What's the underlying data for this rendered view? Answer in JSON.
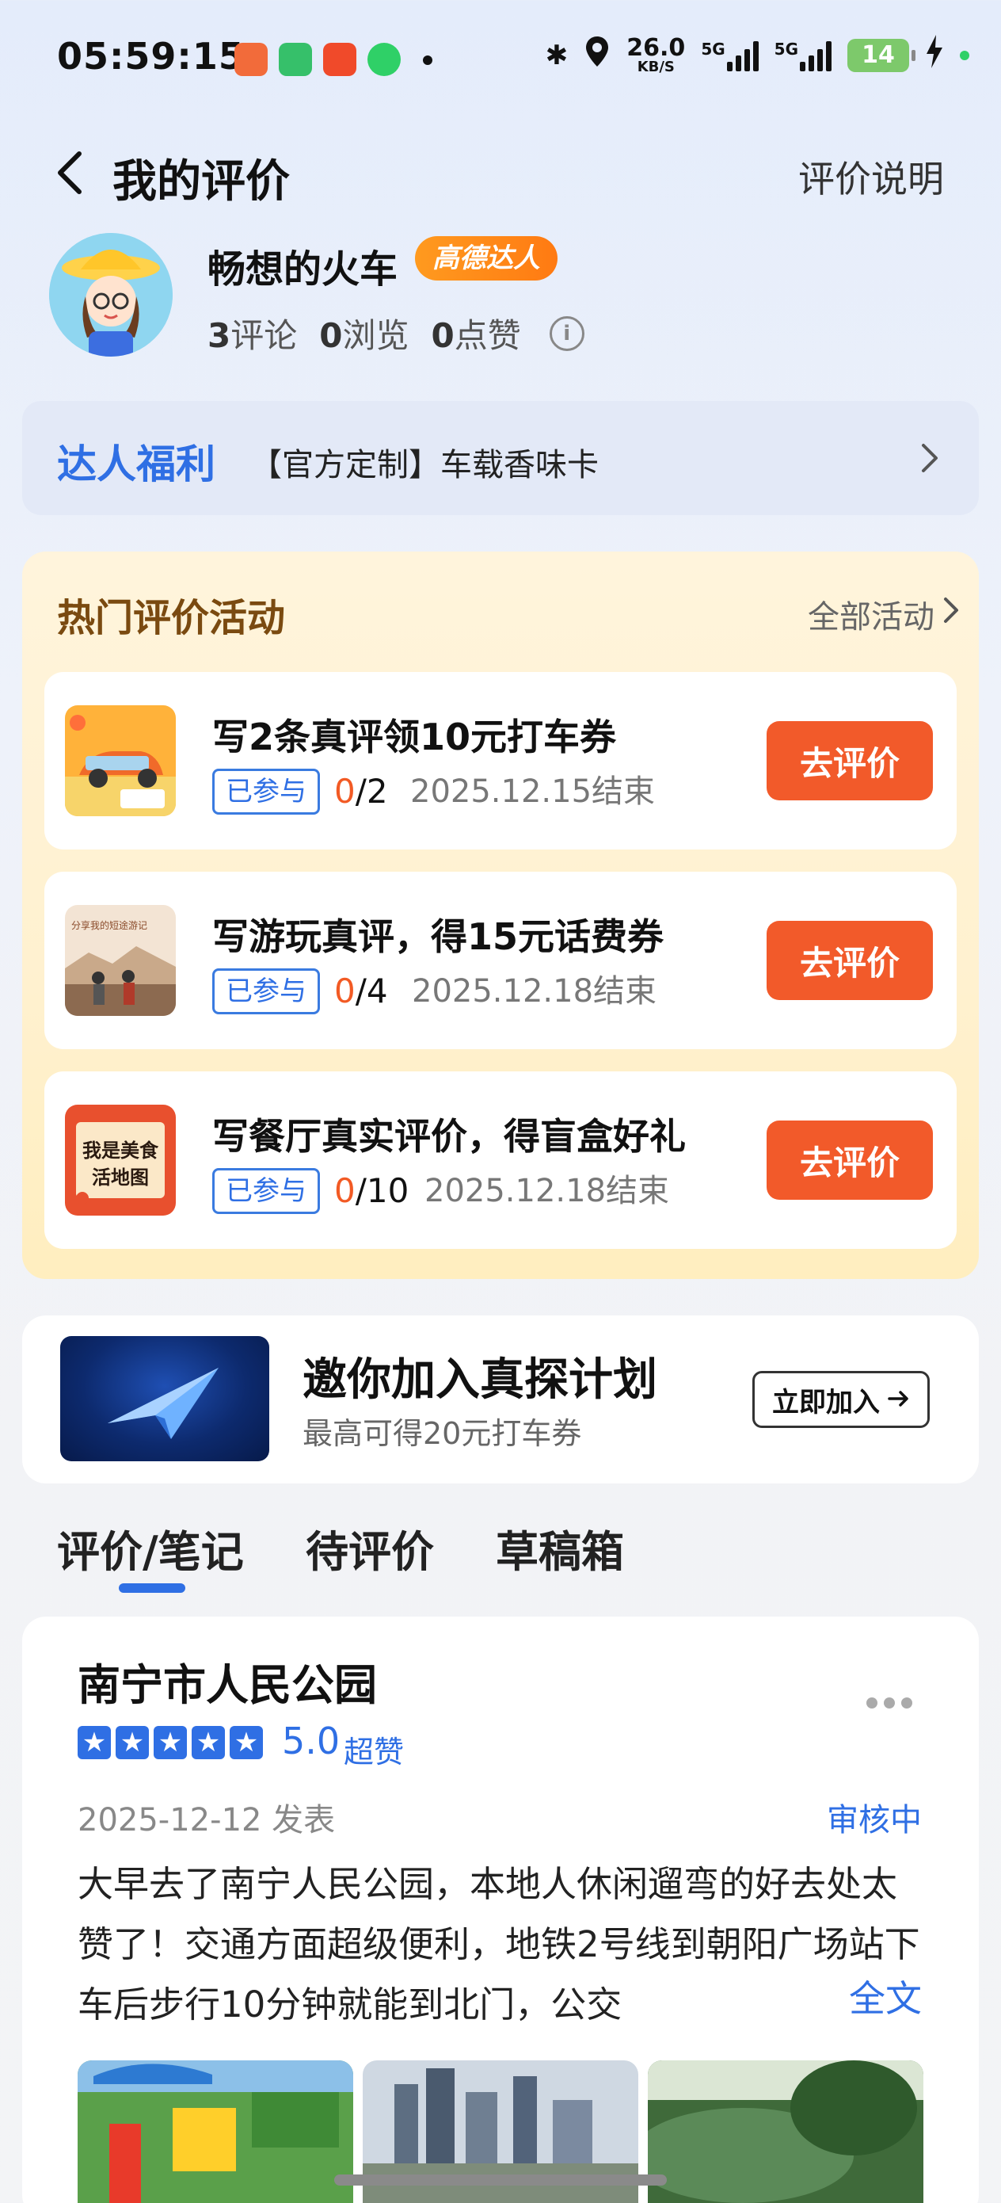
{
  "status_bar": {
    "time": "05:59:15",
    "net_speed": "26.0",
    "net_unit": "KB/S",
    "sig1_label": "5G",
    "sig2_label": "5G",
    "battery": "14"
  },
  "header": {
    "title": "我的评价",
    "rule_link": "评价说明"
  },
  "profile": {
    "username": "畅想的火车",
    "badge": "高德达人",
    "reviews_count": "3",
    "reviews_label": "评论",
    "views_count": "0",
    "views_label": "浏览",
    "likes_count": "0",
    "likes_label": "点赞"
  },
  "perk": {
    "title": "达人福利",
    "text": "【官方定制】车载香味卡"
  },
  "activities": {
    "title": "热门评价活动",
    "all_label": "全部活动",
    "items": [
      {
        "title": "写2条真评领10元打车券",
        "tag": "已参与",
        "done": "0",
        "total": "/2",
        "deadline": "2025.12.15结束",
        "button": "去评价"
      },
      {
        "title": "写游玩真评，得15元话费券",
        "tag": "已参与",
        "done": "0",
        "total": "/4",
        "deadline": "2025.12.18结束",
        "button": "去评价",
        "thumb_text": "分享我的短途游记"
      },
      {
        "title": "写餐厅真实评价，得盲盒好礼",
        "tag": "已参与",
        "done": "0",
        "total": "/10",
        "deadline": "2025.12.18结束",
        "button": "去评价",
        "thumb_text_1": "我是美食",
        "thumb_text_2": "活地图"
      }
    ]
  },
  "invite": {
    "title": "邀你加入真探计划",
    "subtitle": "最高可得20元打车券",
    "button": "立即加入"
  },
  "tabs": [
    "评价/笔记",
    "待评价",
    "草稿箱"
  ],
  "review": {
    "place": "南宁市人民公园",
    "rating": 5,
    "score": "5.0",
    "score_word": "超赞",
    "date": "2025-12-12 发表",
    "status": "审核中",
    "body": "大早去了南宁人民公园，本地人休闲遛弯的好去处太赞了！交通方面超级便利，地铁2号线到朝阳广场站下车后步行10分钟就能到北门，公交",
    "full_link": "全文"
  },
  "colors": {
    "accent": "#2f6fe4",
    "cta": "#f25a2a",
    "badge": "#ff8a1a"
  }
}
